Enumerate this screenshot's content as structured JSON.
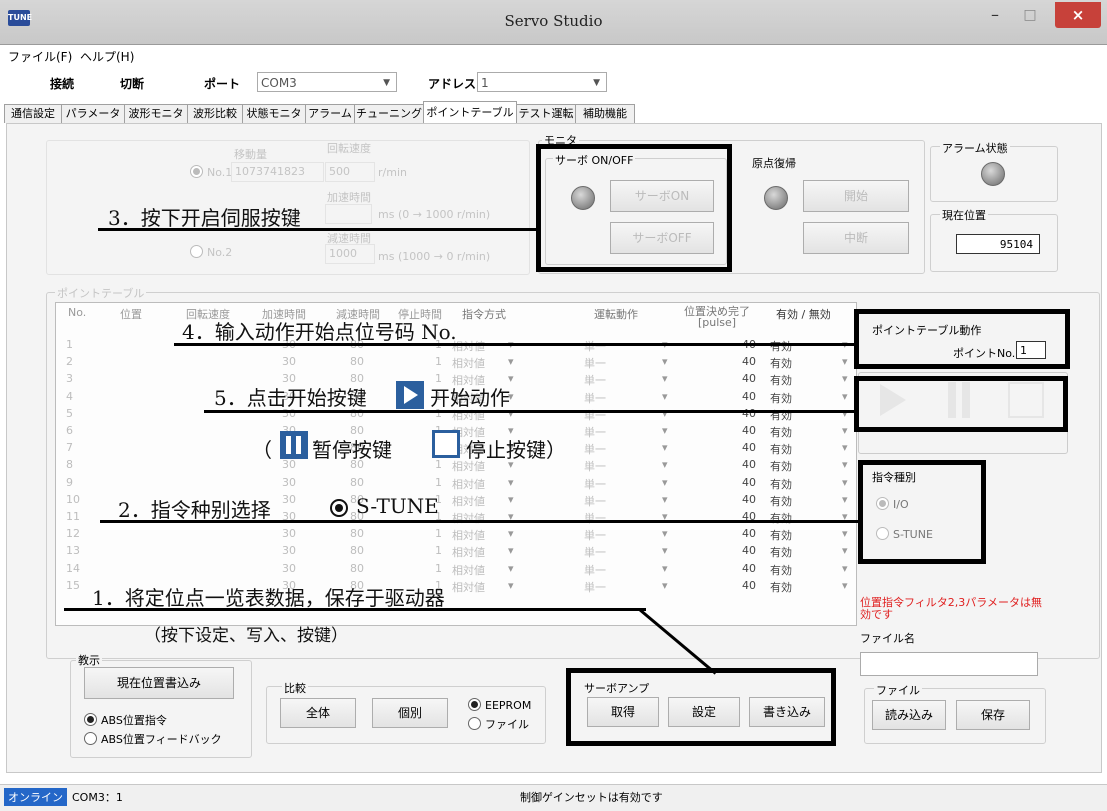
{
  "window": {
    "title": "Servo Studio",
    "icon_text": "TUNE",
    "minimize": "–",
    "maximize": "□",
    "close": "×"
  },
  "menu": [
    "ファイル(F)",
    "ヘルプ(H)"
  ],
  "toolbar": {
    "connect": "接続",
    "disconnect": "切断",
    "port_label": "ポート",
    "port_value": "COM3",
    "address_label": "アドレス",
    "address_value": "1"
  },
  "tabs": [
    "通信設定",
    "パラメータ",
    "波形モニタ",
    "波形比較",
    "状態モニタ",
    "アラーム",
    "チューニング",
    "ポイントテーブル",
    "テスト運転",
    "補助機能"
  ],
  "jog": {
    "label": "ポイントテーブル",
    "movement": "移動量",
    "speed": "回転速度",
    "no1": "No.1",
    "pos1": "1073741823",
    "speed_val": "500",
    "speed_unit": "r/min",
    "accel": "加速時間",
    "accel_unit": "ms (0 → 1000 r/min)",
    "decel": "減速時間",
    "decel_val": "1000",
    "decel_unit": "ms (1000 → 0 r/min)",
    "no2": "No.2"
  },
  "monitor": {
    "label": "モニタ",
    "servo_group": "サーボ ON/OFF",
    "servo_on": "サーボON",
    "servo_off": "サーボOFF",
    "origin_group": "原点復帰",
    "origin_start": "開始",
    "origin_stop": "中断"
  },
  "alarm": {
    "label": "アラーム状態"
  },
  "position": {
    "label": "現在位置",
    "value": "95104"
  },
  "table": {
    "label": "ポイントテーブル",
    "headers": [
      "No.",
      "位置",
      "回転速度",
      "加速時間",
      "減速時間",
      "停止時間",
      "指令方式",
      "運転動作",
      "位置決め完了\n[pulse]",
      "有効 / 無効"
    ],
    "rows": [
      {
        "no": "1",
        "accel": "30",
        "decel": "80",
        "stop": "1",
        "mode": "相対値",
        "op": "単一",
        "done": "40",
        "valid": "有効"
      },
      {
        "no": "2",
        "accel": "30",
        "decel": "80",
        "stop": "1",
        "mode": "相対値",
        "op": "単一",
        "done": "40",
        "valid": "有効"
      },
      {
        "no": "3",
        "accel": "30",
        "decel": "80",
        "stop": "1",
        "mode": "相対値",
        "op": "単一",
        "done": "40",
        "valid": "有効"
      },
      {
        "no": "4",
        "accel": "30",
        "decel": "80",
        "stop": "1",
        "mode": "相対値",
        "op": "単一",
        "done": "40",
        "valid": "有効"
      },
      {
        "no": "5",
        "accel": "30",
        "decel": "80",
        "stop": "1",
        "mode": "相対値",
        "op": "単一",
        "done": "40",
        "valid": "有効"
      },
      {
        "no": "6",
        "accel": "30",
        "decel": "80",
        "stop": "1",
        "mode": "相対値",
        "op": "単一",
        "done": "40",
        "valid": "有効"
      },
      {
        "no": "7",
        "accel": "30",
        "decel": "80",
        "stop": "1",
        "mode": "相対値",
        "op": "単一",
        "done": "40",
        "valid": "有効"
      },
      {
        "no": "8",
        "accel": "30",
        "decel": "80",
        "stop": "1",
        "mode": "相対値",
        "op": "単一",
        "done": "40",
        "valid": "有効"
      },
      {
        "no": "9",
        "accel": "30",
        "decel": "80",
        "stop": "1",
        "mode": "相対値",
        "op": "単一",
        "done": "40",
        "valid": "有効"
      },
      {
        "no": "10",
        "accel": "30",
        "decel": "80",
        "stop": "1",
        "mode": "相対値",
        "op": "単一",
        "done": "40",
        "valid": "有効"
      },
      {
        "no": "11",
        "accel": "30",
        "decel": "80",
        "stop": "1",
        "mode": "相対値",
        "op": "単一",
        "done": "40",
        "valid": "有効"
      },
      {
        "no": "12",
        "accel": "30",
        "decel": "80",
        "stop": "1",
        "mode": "相対値",
        "op": "単一",
        "done": "40",
        "valid": "有効"
      },
      {
        "no": "13",
        "accel": "30",
        "decel": "80",
        "stop": "1",
        "mode": "相対値",
        "op": "単一",
        "done": "40",
        "valid": "有効"
      },
      {
        "no": "14",
        "accel": "30",
        "decel": "80",
        "stop": "1",
        "mode": "相対値",
        "op": "単一",
        "done": "40",
        "valid": "有効"
      },
      {
        "no": "15",
        "accel": "30",
        "decel": "80",
        "stop": "1",
        "mode": "相対値",
        "op": "単一",
        "done": "40",
        "valid": "有効"
      }
    ]
  },
  "pt_action": {
    "label": "ポイントテーブル動作",
    "point_label": "ポイントNo.",
    "point_value": "1"
  },
  "cmd_type": {
    "label": "指令種別",
    "io": "I/O",
    "stune": "S-TUNE"
  },
  "warning": "位置指令フィルタ2,3パラメータは無効です",
  "filename": {
    "label": "ファイル名",
    "value": ""
  },
  "file_group": {
    "label": "ファイル",
    "read": "読み込み",
    "save": "保存"
  },
  "teach": {
    "label": "教示",
    "write_pos": "現在位置書込み",
    "abs_cmd": "ABS位置指令",
    "abs_fb": "ABS位置フィードバック"
  },
  "compare": {
    "label": "比較",
    "all": "全体",
    "single": "個別",
    "eeprom": "EEPROM",
    "file": "ファイル"
  },
  "amp": {
    "label": "サーボアンプ",
    "get": "取得",
    "set": "設定",
    "write": "書き込み"
  },
  "status": {
    "online": "オンライン",
    "port": "COM3：1",
    "message": "制御ゲインセットは有効です"
  },
  "annotations": {
    "a1": "1．将定位点一览表数据，保存于驱动器",
    "a1b": "（按下设定、写入、按键）",
    "a2": "2．指令种别选择",
    "a2b": "S-TUNE",
    "a3": "3．按下开启伺服按键",
    "a4": "4．输入动作开始点位号码 No.",
    "a5a": "5．点击开始按键",
    "a5b": "开始动作",
    "a5c": "（",
    "a5d": "暂停按键",
    "a5e": "停止按键）"
  }
}
